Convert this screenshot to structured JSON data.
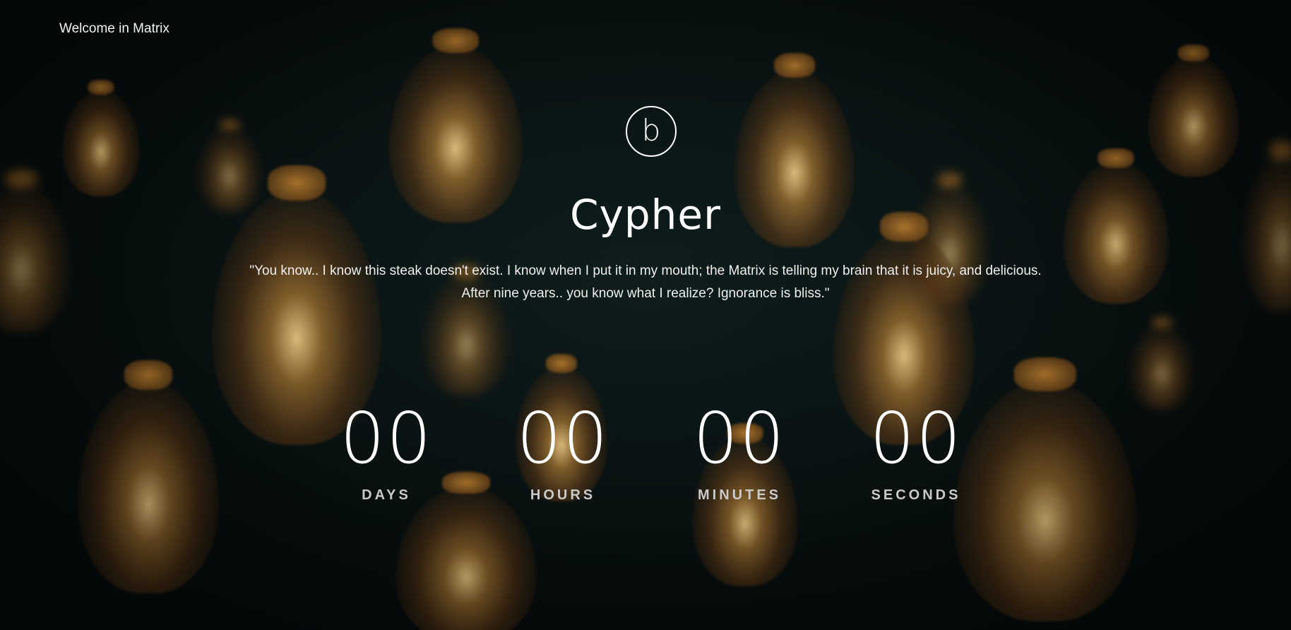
{
  "header": {
    "welcome_text": "Welcome in Matrix"
  },
  "logo": {
    "letter": "b"
  },
  "main": {
    "title": "Cypher",
    "quote_line1": "\"You know.. I know this steak doesn't exist. I know when I put it in my mouth; the Matrix is telling my brain that it is juicy, and delicious.",
    "quote_line2": "After nine years.. you know what I realize? Ignorance is bliss.\""
  },
  "countdown": {
    "units": [
      {
        "value": "00",
        "label": "DAYS"
      },
      {
        "value": "00",
        "label": "HOURS"
      },
      {
        "value": "00",
        "label": "MINUTES"
      },
      {
        "value": "00",
        "label": "SECONDS"
      }
    ]
  },
  "colors": {
    "text": "#ffffff",
    "label": "#c9c9c9",
    "background": "#0c1312",
    "bulb_glow": "#e8a85a"
  }
}
